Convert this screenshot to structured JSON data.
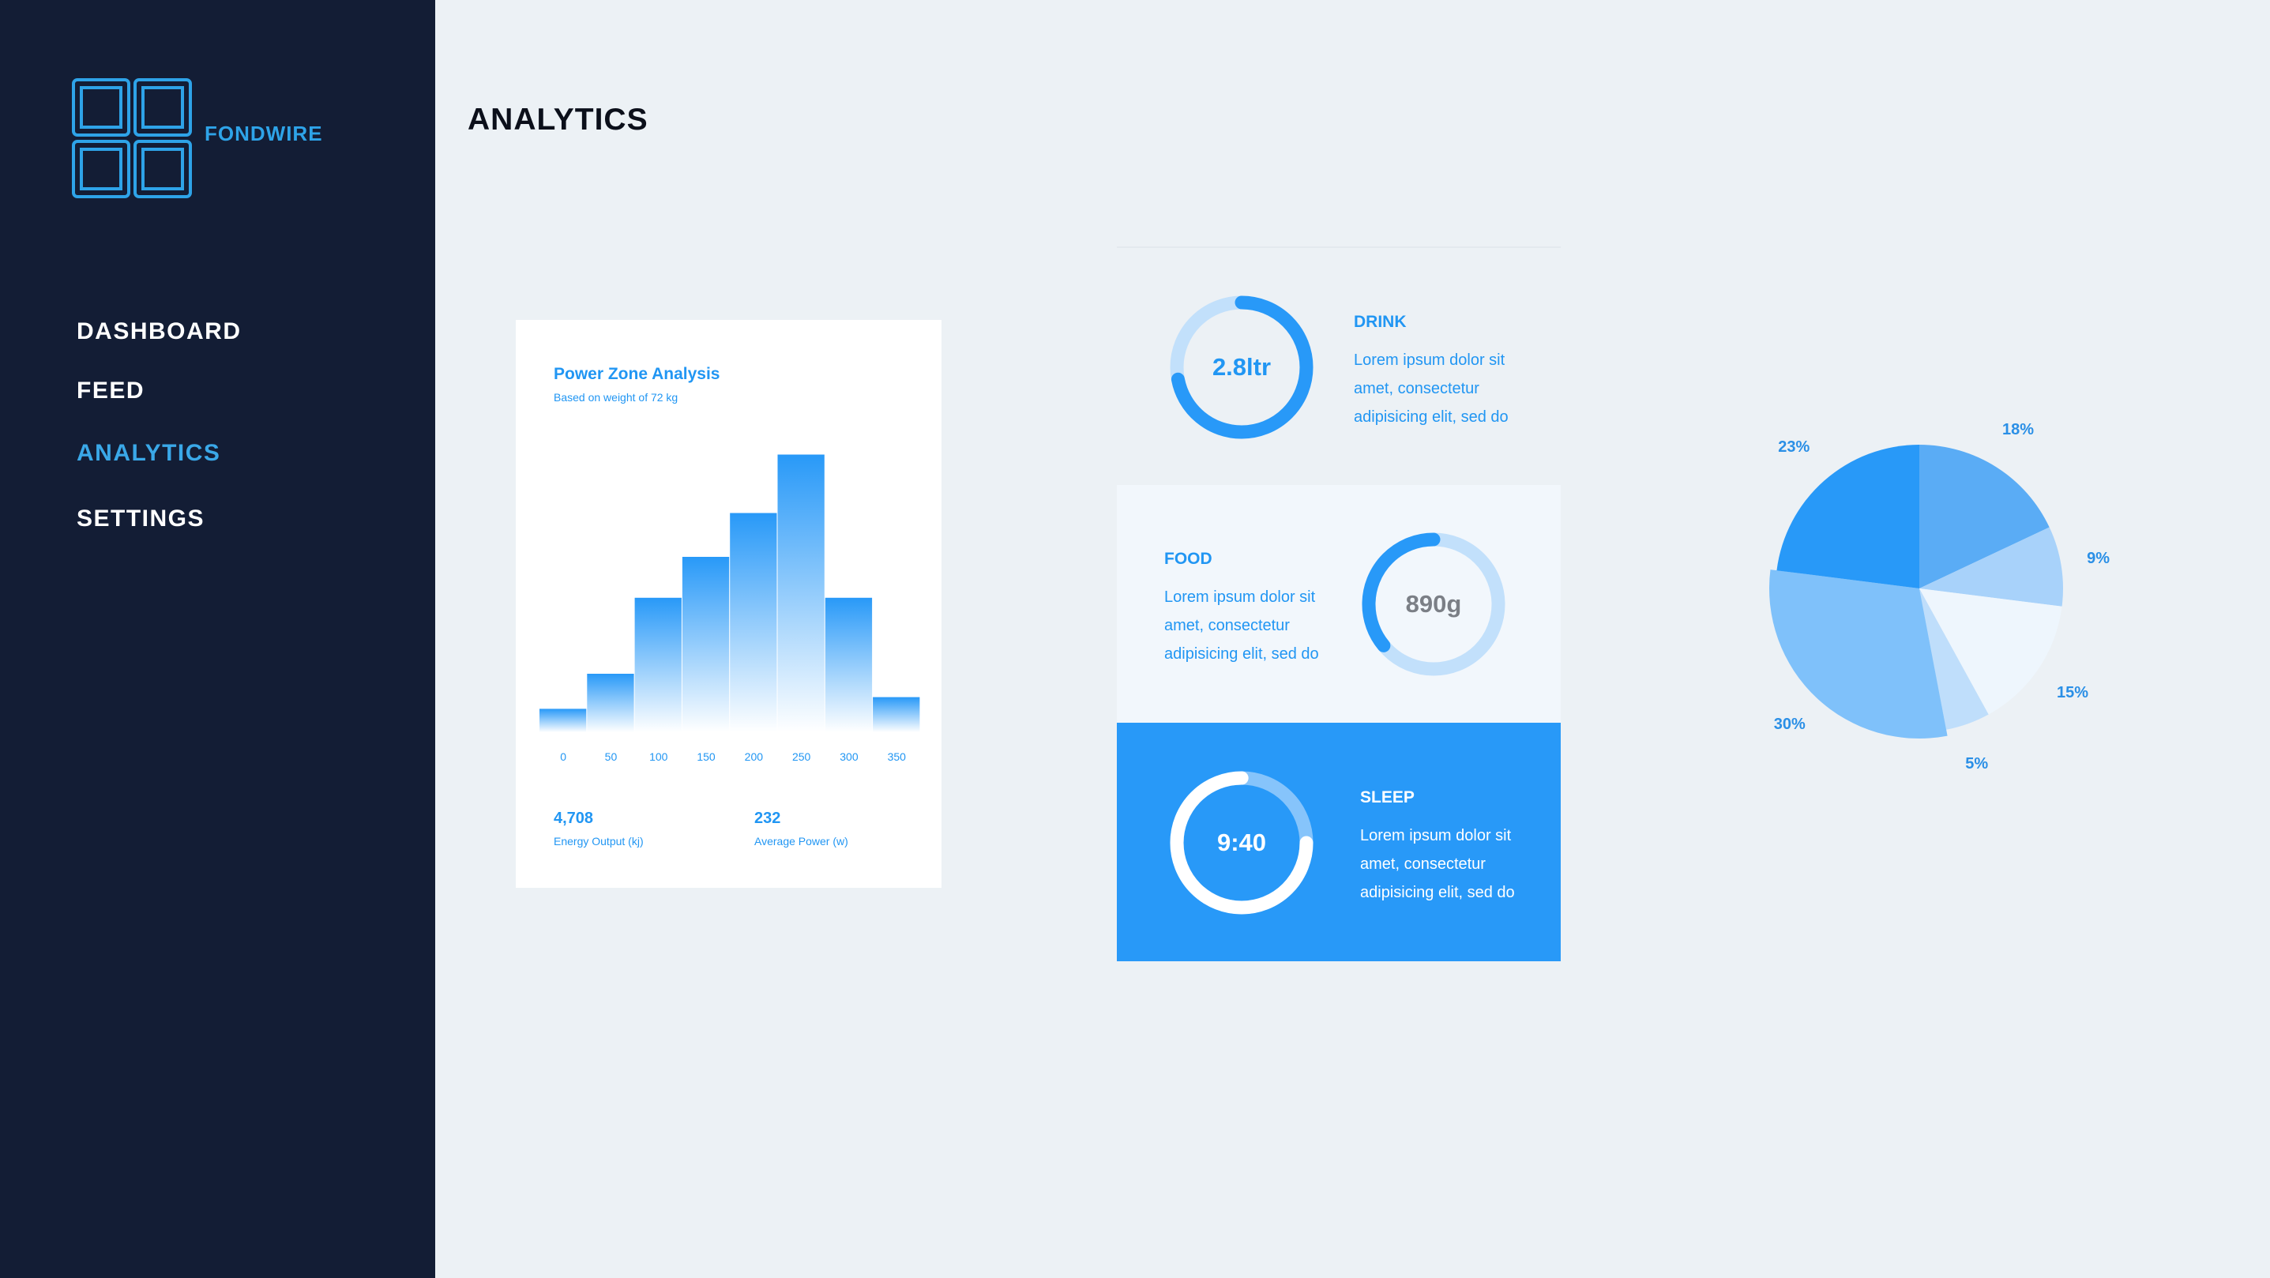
{
  "sidebar": {
    "brand": "FONDWIRE",
    "logo_icon": "grid-logo-icon",
    "nav": [
      {
        "label": "DASHBOARD",
        "active": false
      },
      {
        "label": "FEED",
        "active": false
      },
      {
        "label": "ANALYTICS",
        "active": true
      },
      {
        "label": "SETTINGS",
        "active": false
      }
    ]
  },
  "header": {
    "title": "ANALYTICS"
  },
  "power_card": {
    "title": "Power Zone Analysis",
    "subtitle": "Based on weight of 72 kg",
    "stats": [
      {
        "value": "4,708",
        "label": "Energy Output (kj)"
      },
      {
        "value": "232",
        "label": "Average Power (w)"
      }
    ]
  },
  "metrics": {
    "drink": {
      "value": "2.8ltr",
      "heading": "DRINK",
      "text": "Lorem ipsum dolor sit amet, consectetur adipisicing elit, sed do",
      "progress": 0.72
    },
    "food": {
      "value": "890g",
      "heading": "FOOD",
      "text": "Lorem ipsum dolor sit amet, consectetur adipisicing elit, sed do",
      "progress": 0.36
    },
    "sleep": {
      "value": "9:40",
      "heading": "SLEEP",
      "text": "Lorem ipsum dolor sit amet, consectetur adipisicing elit, sed do",
      "progress": 0.75
    }
  },
  "colors": {
    "sidebar_bg": "#131d35",
    "accent": "#2899f8",
    "active_nav": "#3aa8e8",
    "ring_track": "#c2e0fb"
  },
  "chart_data": [
    {
      "type": "bar",
      "title": "Power Zone Analysis",
      "subtitle": "Based on weight of 72 kg",
      "categories": [
        "0",
        "50",
        "100",
        "150",
        "200",
        "250",
        "300",
        "350"
      ],
      "values": [
        8,
        20,
        46,
        60,
        75,
        95,
        46,
        12
      ],
      "ylim": [
        0,
        100
      ],
      "grid": false
    },
    {
      "type": "pie",
      "labels": [
        "18%",
        "9%",
        "15%",
        "5%",
        "30%",
        "23%"
      ],
      "values": [
        18,
        9,
        15,
        5,
        30,
        23
      ],
      "colors": [
        "#5aacf5",
        "#a8d2fa",
        "#eef6fd",
        "#bfdefb",
        "#7fc1fa",
        "#2899f8"
      ]
    }
  ]
}
